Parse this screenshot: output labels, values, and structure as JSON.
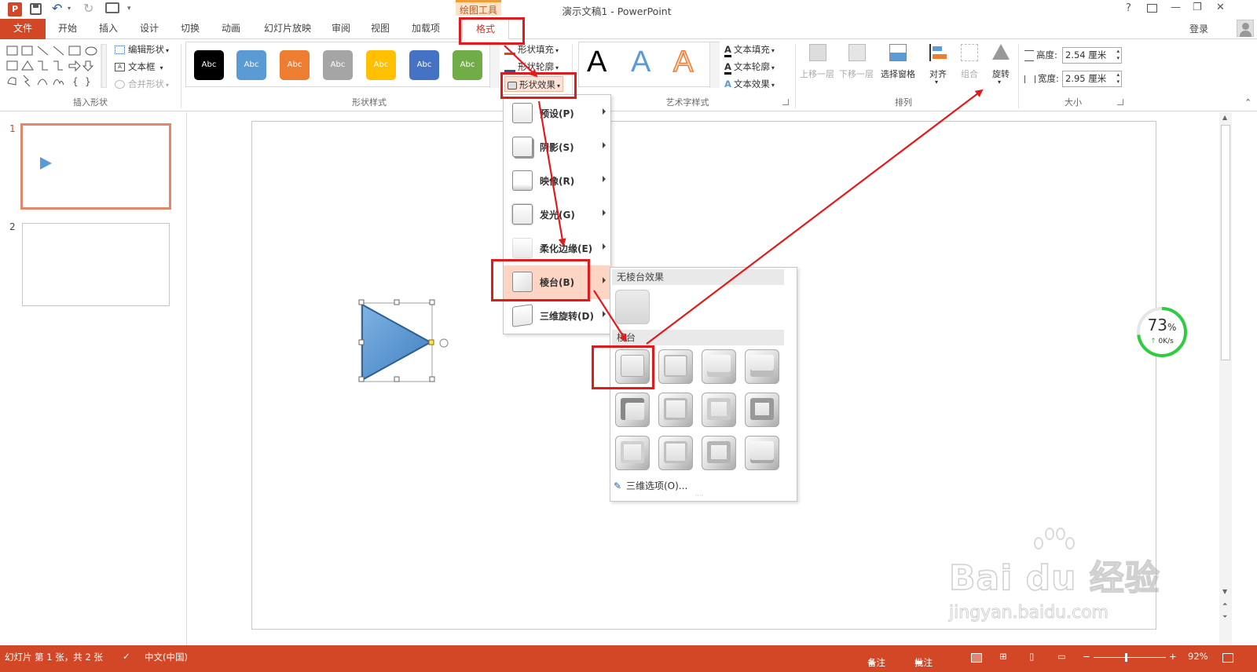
{
  "window": {
    "title": "演示文稿1 - PowerPoint",
    "context_tab_group": "绘图工具",
    "login": "登录",
    "help_glyph": "?",
    "min_glyph": "—",
    "restore_glyph": "❐",
    "close_glyph": "✕"
  },
  "tabs": [
    "文件",
    "开始",
    "插入",
    "设计",
    "切换",
    "动画",
    "幻灯片放映",
    "审阅",
    "视图",
    "加载项",
    "格式"
  ],
  "ribbon": {
    "insert_shapes": {
      "edit_shape": "编辑形状",
      "text_box": "文本框",
      "merge_shapes": "合并形状",
      "label": "插入形状"
    },
    "shape_styles": {
      "swatch_text": "Abc",
      "swatches": [
        "#000000",
        "#5b9bd5",
        "#ed7d31",
        "#a5a5a5",
        "#ffc000",
        "#4472c4",
        "#70ad47"
      ],
      "fill": "形状填充",
      "outline": "形状轮廓",
      "effects": "形状效果",
      "label": "形状样式"
    },
    "wordart": {
      "letter": "A",
      "text_fill": "文本填充",
      "text_outline": "文本轮廓",
      "text_effects": "文本效果",
      "label": "艺术字样式"
    },
    "arrange": {
      "bring_forward": "上移一层",
      "send_backward": "下移一层",
      "selection_pane": "选择窗格",
      "align": "对齐",
      "group": "组合",
      "rotate": "旋转",
      "label": "排列"
    },
    "size": {
      "height_label": "高度:",
      "height_value": "2.54 厘米",
      "width_label": "宽度:",
      "width_value": "2.95 厘米",
      "label": "大小"
    }
  },
  "slides": [
    {
      "number": "1",
      "selected": true
    },
    {
      "number": "2",
      "selected": false
    }
  ],
  "effects_menu": {
    "items": [
      {
        "label": "预设(P)"
      },
      {
        "label": "阴影(S)"
      },
      {
        "label": "映像(R)"
      },
      {
        "label": "发光(G)"
      },
      {
        "label": "柔化边缘(E)"
      },
      {
        "label": "棱台(B)"
      },
      {
        "label": "三维旋转(D)"
      }
    ],
    "highlighted": "棱台(B)"
  },
  "bevel_submenu": {
    "no_bevel_header": "无棱台效果",
    "bevel_header": "棱台",
    "options_link": "三维选项(O)...",
    "grid_count": 12
  },
  "net_widget": {
    "percent": "73",
    "percent_sign": "%",
    "speed": "0K/s",
    "level": 0.73
  },
  "watermark": {
    "brand": "Bai du 经验",
    "url": "jingyan.baidu.com"
  },
  "statusbar": {
    "slide_info": "幻灯片 第 1 张，共 2 张",
    "language": "中文(中国)",
    "notes": "备注",
    "comments": "批注",
    "zoom_minus": "−",
    "zoom_plus": "+",
    "zoom": "92%"
  },
  "colors": {
    "accent": "#d24726",
    "triangle_fill": "#5b9bd5",
    "annotation_red": "#e01b1b",
    "menu_highlight": "#fcd5c5",
    "ok_green": "#2ecc40"
  }
}
